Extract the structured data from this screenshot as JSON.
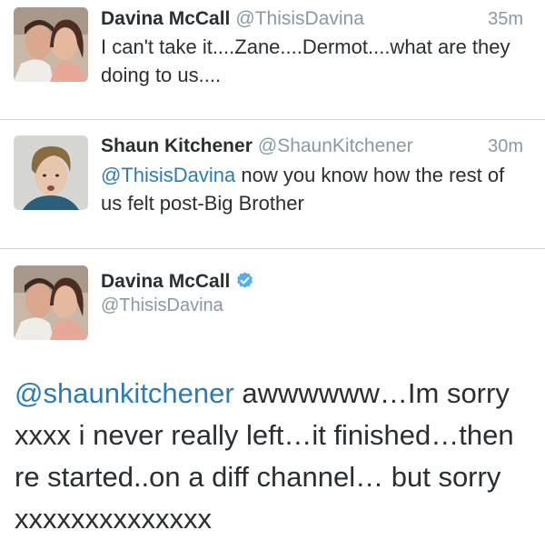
{
  "tweets": [
    {
      "name": "Davina McCall",
      "handle": "@ThisisDavina",
      "time": "35m",
      "text": "I can't take it....Zane....Dermot....what are they doing to us...."
    },
    {
      "name": "Shaun Kitchener",
      "handle": "@ShaunKitchener",
      "time": "30m",
      "text": "@ThisisDavina now you know how the rest of us felt post-Big Brother"
    }
  ],
  "detail": {
    "name": "Davina McCall",
    "handle": "@ThisisDavina",
    "mention": "@shaunkitchener",
    "text": " awwwwww…Im sorry xxxx i never really left…it finished…then re started..on a diff channel… but sorry xxxxxxxxxxxxxx"
  },
  "colors": {
    "link": "#2b7bb9",
    "meta": "#8899a6",
    "verified": "#55acee"
  },
  "icons": {
    "verified": "verified-badge-icon"
  }
}
